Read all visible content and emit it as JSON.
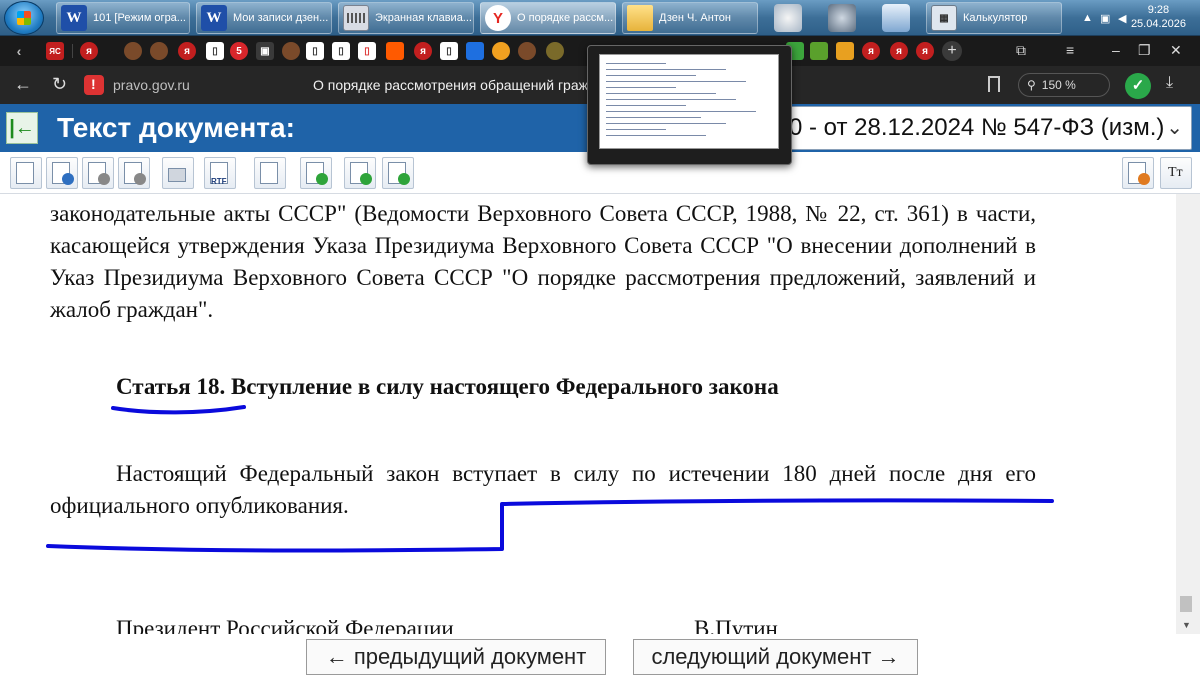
{
  "taskbar": {
    "tasks": [
      {
        "label": "101 [Режим огра...",
        "icon": "word-icon"
      },
      {
        "label": "Мои записи дзен...",
        "icon": "word-icon"
      },
      {
        "label": "Экранная клавиа...",
        "icon": "keyboard-icon"
      },
      {
        "label": "О порядке рассм...",
        "icon": "yandex-browser-icon"
      },
      {
        "label": "Дзен Ч. Антон",
        "icon": "folder-icon"
      },
      {
        "label": "Калькулятор",
        "icon": "calculator-icon"
      }
    ],
    "clock_time": "9:28",
    "clock_date": "25.04.2026"
  },
  "browser": {
    "url": "pravo.gov.ru",
    "page_title": "О порядке рассмотрения обращений граж",
    "zoom": "150 %",
    "tab_chips": [
      "ЯС",
      "я",
      "я",
      "я",
      "я",
      "5",
      "я",
      "я",
      "я",
      "я"
    ]
  },
  "header": {
    "title": "Текст документа:",
    "document_select": "0 - от 28.12.2024 № 547-ФЗ (изм.)"
  },
  "document": {
    "para1": "законодательные акты СССР\" (Ведомости Верховного Совета СССР, 1988, № 22, ст. 361) в части, касающейся утверждения Указа Президиума Верховного Совета СССР \"О внесении дополнений в Указ Президиума Верховного Совета СССР \"О порядке рассмотрения предложений, заявлений и жалоб граждан\".",
    "article_heading": "Статья 18. Вступление в силу настоящего Федерального закона",
    "para2": "Настоящий Федеральный закон вступает в силу по истечении 180 дней после дня его официального опубликования.",
    "signature_left": "Президент Российской Федерации",
    "signature_right": "В.Путин"
  },
  "bottom_nav": {
    "prev_label": "← предыдущий документ",
    "next_label": "следующий документ →"
  },
  "colors": {
    "header_bg": "#1f63a8",
    "annotation": "#0a0adc",
    "taskbar": "#3d6f98"
  }
}
